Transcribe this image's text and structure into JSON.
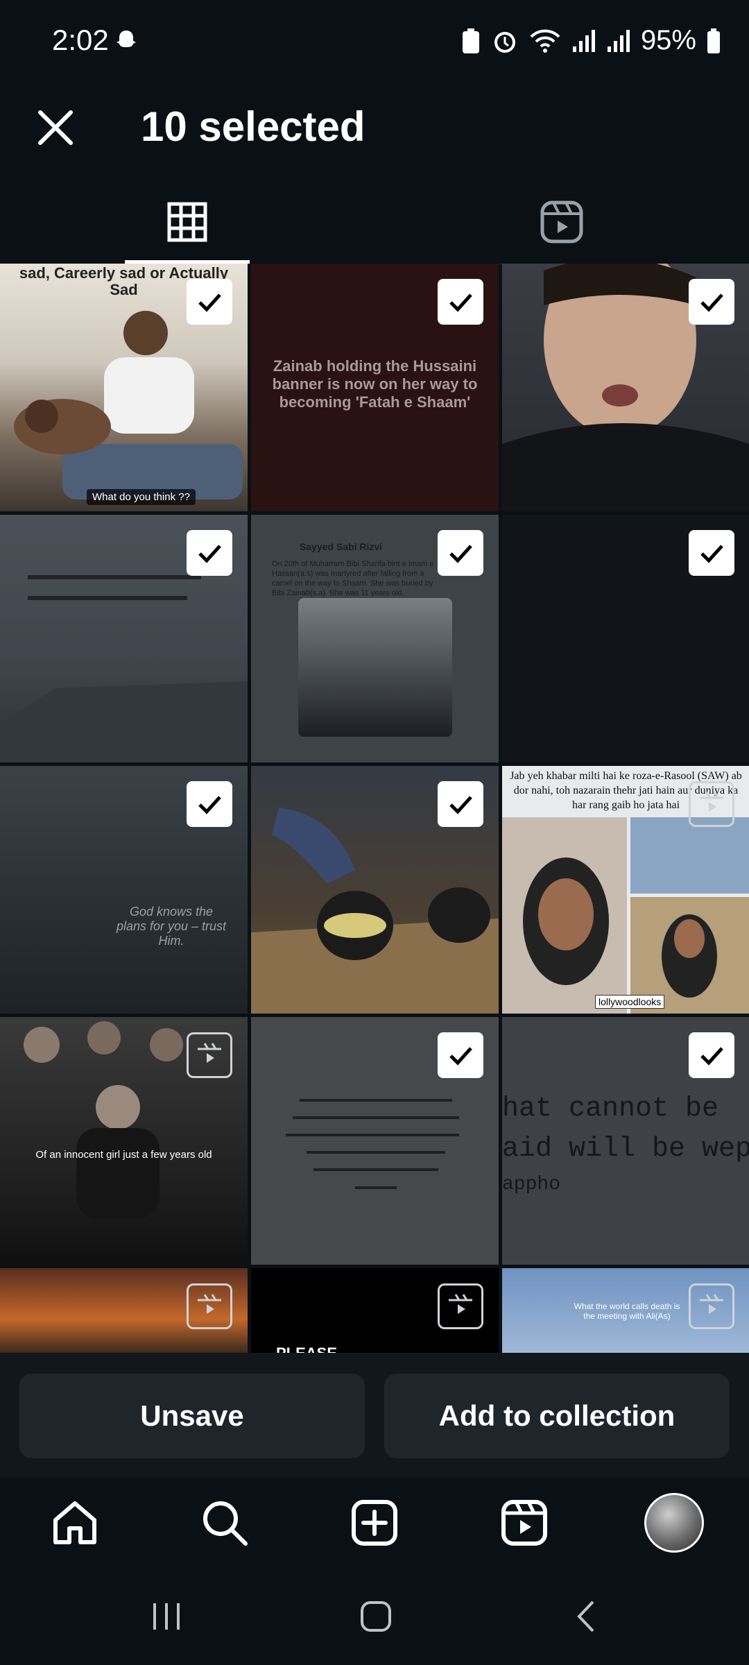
{
  "status_bar": {
    "time": "2:02",
    "battery_percent": "95%",
    "icons": [
      "snapchat-icon",
      "battery-saver-icon",
      "alarm-icon",
      "wifi-icon",
      "signal-icon",
      "signal-icon",
      "battery-icon"
    ]
  },
  "header": {
    "title": "10 selected",
    "close_icon": "close-icon"
  },
  "tabs": [
    {
      "name": "grid-icon",
      "active": true
    },
    {
      "name": "reels-icon",
      "active": false
    }
  ],
  "grid": {
    "items": [
      {
        "type": "post",
        "selected": true,
        "caption": "sad, Careerly sad or Actually Sad",
        "caption2": "What do you think ??"
      },
      {
        "type": "post",
        "selected": true,
        "caption": "Zainab holding the Hussaini banner is now on her way to becoming 'Fatah e Shaam'"
      },
      {
        "type": "post",
        "selected": true,
        "caption": ""
      },
      {
        "type": "post",
        "selected": true,
        "caption": ""
      },
      {
        "type": "post",
        "selected": true,
        "caption": "Sayyed Sabi Rizvi",
        "caption2": "On 20th of Muharram Bibi Sharifa bint e Imam e Hassan(a.s) was martyred after falling from a camel on the way to Shaam. She was buried by Bibi Zainab(s.a). She was 11 years old."
      },
      {
        "type": "post",
        "selected": true,
        "caption": ""
      },
      {
        "type": "post",
        "selected": true,
        "caption": "God knows the plans for you – trust Him."
      },
      {
        "type": "post",
        "selected": true,
        "caption": ""
      },
      {
        "type": "reel",
        "selected": false,
        "caption": "Jab yeh khabar milti hai ke roza-e-Rasool (SAW) ab dor nahi, toh nazarain thehr jati hain aur duniya ka har rang gaib ho jata hai",
        "caption2": "lollywoodlooks"
      },
      {
        "type": "reel",
        "selected": false,
        "caption": "Of an innocent girl just a few years old"
      },
      {
        "type": "post",
        "selected": true,
        "caption": ""
      },
      {
        "type": "post",
        "selected": true,
        "caption": "hat cannot be",
        "caption2": "aid will be wept",
        "caption3": "appho"
      },
      {
        "type": "reel",
        "selected": false,
        "caption": ""
      },
      {
        "type": "reel",
        "selected": false,
        "caption": "PLEASE"
      },
      {
        "type": "reel",
        "selected": false,
        "caption": "What the world calls death is the meeting with Ali(As)"
      }
    ]
  },
  "actions": {
    "unsave_label": "Unsave",
    "add_to_collection_label": "Add to collection"
  },
  "bottom_nav": [
    "home-icon",
    "search-icon",
    "create-icon",
    "reels-icon",
    "profile-avatar"
  ],
  "system_nav": [
    "recents-icon",
    "home-button-icon",
    "back-icon"
  ],
  "colors": {
    "background": "#0b1014",
    "check_bg": "#ffffff",
    "button_bg": "#1f252b"
  }
}
